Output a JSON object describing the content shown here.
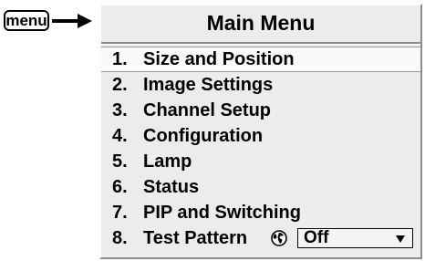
{
  "menu_key": {
    "label": "menu"
  },
  "icons": {
    "pointer": "right-arrow-icon",
    "globe": "globe-icon",
    "dropdown": "chevron-down-icon"
  },
  "menu": {
    "title": "Main Menu",
    "items": [
      {
        "number": "1.",
        "label": "Size and Position",
        "selected": true
      },
      {
        "number": "2.",
        "label": "Image Settings"
      },
      {
        "number": "3.",
        "label": "Channel Setup"
      },
      {
        "number": "4.",
        "label": "Configuration"
      },
      {
        "number": "5.",
        "label": "Lamp"
      },
      {
        "number": "6.",
        "label": "Status"
      },
      {
        "number": "7.",
        "label": "PIP and Switching"
      },
      {
        "number": "8.",
        "label": "Test Pattern",
        "select_value": "Off"
      }
    ]
  }
}
